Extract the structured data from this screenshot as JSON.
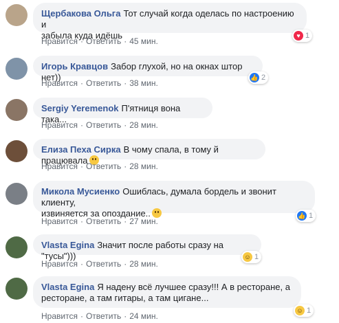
{
  "action_labels": {
    "like": "Нравится",
    "reply": "Ответить",
    "sep": "·"
  },
  "comments": [
    {
      "author": "Щербакова Ольга",
      "text": "Тот случай когда оделась по настроению и\nзабыла куда идёшь",
      "time": "45 мин.",
      "reaction": {
        "type": "love",
        "icon": "heart-icon",
        "count": "1"
      },
      "avatar_color": "#b9a48a"
    },
    {
      "author": "Игорь Кравцов",
      "text": "Забор глухой, но на окнах штор нет))",
      "time": "38 мин.",
      "reaction": {
        "type": "like",
        "icon": "thumbs-up-icon",
        "count": "2"
      },
      "avatar_color": "#7f93a8"
    },
    {
      "author": "Sergiy Yeremenok",
      "text": "П'ятниця вона така...",
      "time": "28 мин.",
      "avatar_color": "#8a7565"
    },
    {
      "author": "Елиза Пеха Сирка",
      "text": "В чому спала, в тому й працювала",
      "time": "28 мин.",
      "emoji": "upside-down-face-icon",
      "avatar_color": "#6d4f3a"
    },
    {
      "author": "Микола Мусиенко",
      "text": "Ошиблась, думала бордель и звонит клиенту,\nизвиняется за опоздание..",
      "time": "27 мин.",
      "emoji": "grinning-tongue-icon",
      "reaction": {
        "type": "like",
        "icon": "thumbs-up-icon",
        "count": "1"
      },
      "avatar_color": "#7a7f86"
    },
    {
      "author": "Vlasta Egina",
      "text": "Значит после работы сразу на \"тусы\")))",
      "time": "28 мин.",
      "reaction": {
        "type": "haha",
        "icon": "laughing-face-icon",
        "count": "1"
      },
      "avatar_color": "#4f6a45"
    },
    {
      "author": "Vlasta Egina",
      "text": "Я надену всё лучшее сразу!!! А в ресторане, а\nресторане, а там гитары, а там цигане...",
      "time": "24 мин.",
      "reaction": {
        "type": "haha",
        "icon": "laughing-face-icon",
        "count": "1"
      },
      "avatar_color": "#4f6a45"
    }
  ]
}
